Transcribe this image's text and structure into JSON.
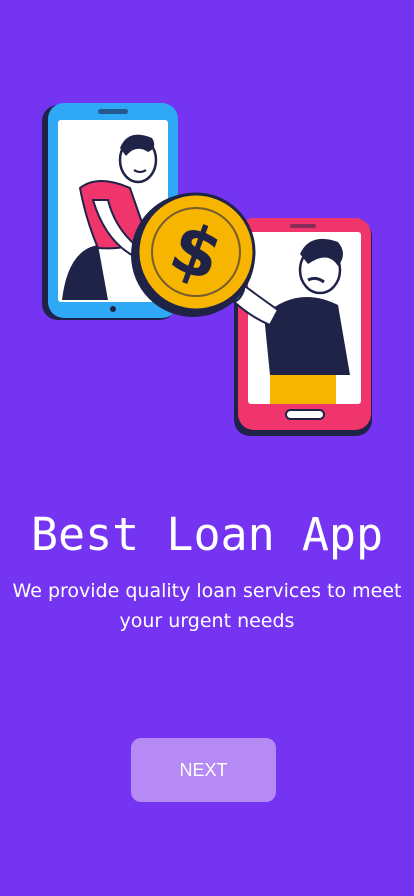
{
  "onboarding": {
    "title": "Best Loan App",
    "subtitle": "We provide quality loan services to meet your urgent needs",
    "next_label": "NEXT"
  },
  "colors": {
    "background": "#7434f2",
    "button": "#b58af4",
    "coin": "#f7b500",
    "phone_left": "#2fa8f5",
    "phone_right": "#f0346c",
    "dark": "#1f2347"
  },
  "icons": {
    "coin": "dollar-coin-icon"
  }
}
